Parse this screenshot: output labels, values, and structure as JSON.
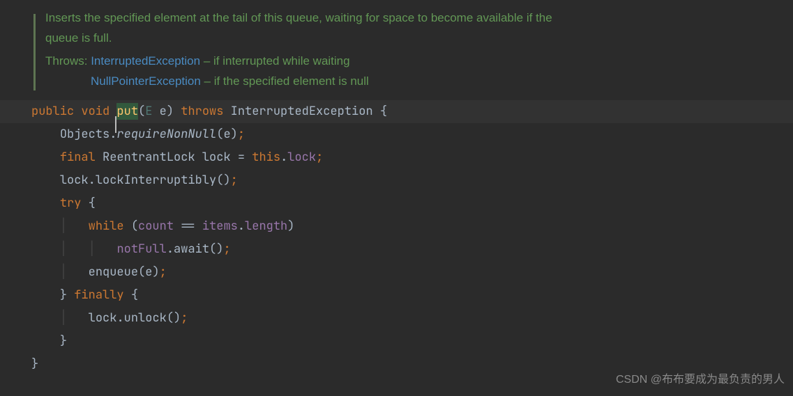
{
  "doc": {
    "line1": "Inserts the specified element at the tail of this queue, waiting for space to become available if the",
    "line2": "queue is full.",
    "throws_label": "Throws:",
    "exception1": "InterruptedException",
    "exception1_desc": " – if interrupted while waiting",
    "exception2": "NullPointerException",
    "exception2_desc": " – if the specified element is null"
  },
  "code": {
    "public": "public",
    "void": "void",
    "put": "put",
    "param_type": "E",
    "param_name": "e",
    "throws_kw": "throws",
    "interrupted_exception": "InterruptedException",
    "objects": "Objects",
    "require_non_null": "requireNonNull",
    "final_kw": "final",
    "reentrant_lock": "ReentrantLock",
    "lock_var": "lock",
    "this_kw": "this",
    "lock_field": "lock",
    "lock_interruptibly": "lockInterruptibly",
    "try_kw": "try",
    "while_kw": "while",
    "count": "count",
    "items": "items",
    "length": "length",
    "not_full": "notFull",
    "await": "await",
    "enqueue": "enqueue",
    "finally_kw": "finally",
    "unlock": "unlock"
  },
  "watermark": "CSDN @布布要成为最负责的男人"
}
